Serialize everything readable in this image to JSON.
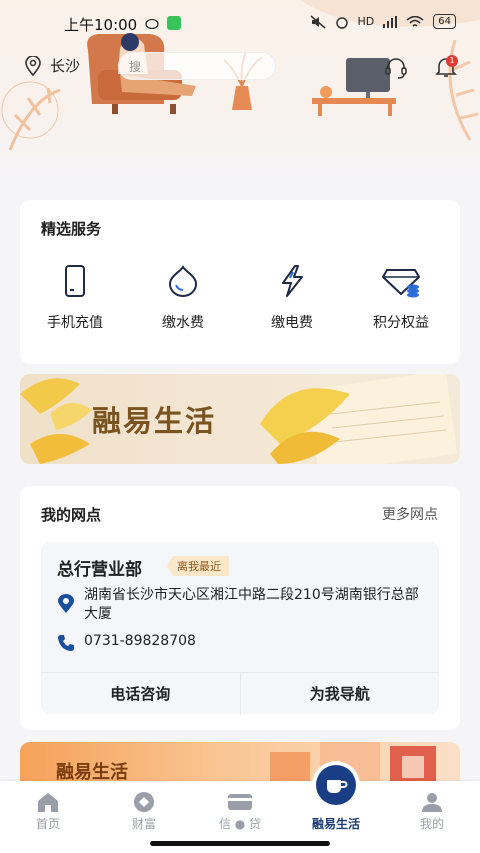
{
  "status_bar": {
    "time": "上午10:00",
    "network": "HD",
    "battery": "64"
  },
  "header": {
    "location": "长沙",
    "search_placeholder": "搜",
    "notification_count": "1"
  },
  "services": {
    "title": "精选服务",
    "items": [
      {
        "label": "手机充值",
        "icon": "phone-icon"
      },
      {
        "label": "缴水费",
        "icon": "water-drop-icon"
      },
      {
        "label": "缴电费",
        "icon": "lightning-icon"
      },
      {
        "label": "积分权益",
        "icon": "diamond-coins-icon"
      }
    ]
  },
  "banner": {
    "title": "融易生活"
  },
  "branch": {
    "title": "我的网点",
    "more": "更多网点",
    "name": "总行营业部",
    "tag": "离我最近",
    "address": "湖南省长沙市天心区湘江中路二段210号湖南银行总部大厦",
    "phone": "0731-89828708",
    "call_label": "电话咨询",
    "nav_label": "为我导航"
  },
  "banner2": {
    "title": "融易生活"
  },
  "tabbar": {
    "items": [
      {
        "label": "首页"
      },
      {
        "label": "财富"
      },
      {
        "label": "信 ● 贷"
      },
      {
        "label": "融易生活"
      },
      {
        "label": "我的"
      }
    ],
    "active_color": "#1c3d73"
  }
}
